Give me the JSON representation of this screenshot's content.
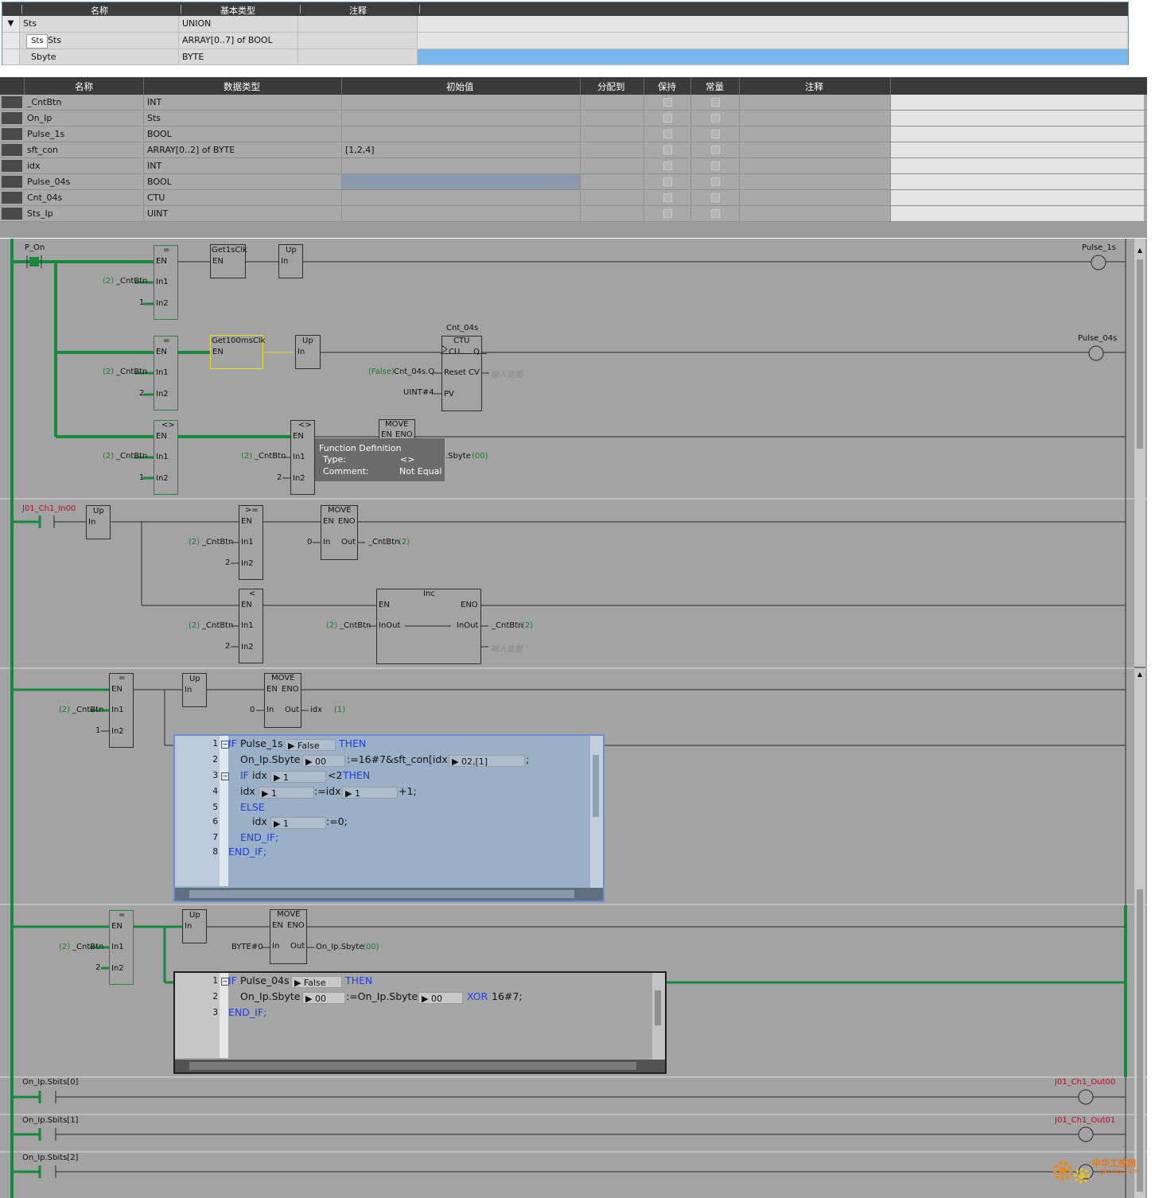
{
  "union_table": {
    "headers": [
      "名称",
      "基本类型",
      "注释"
    ],
    "rows": [
      {
        "expander": "▼",
        "name": "Sts",
        "type": "UNION"
      },
      {
        "name": "Sts",
        "tag": "Sts",
        "type": "ARRAY[0..7] of BOOL"
      },
      {
        "name": "Sbyte",
        "type": "BYTE"
      }
    ]
  },
  "var_table": {
    "headers": [
      "名称",
      "数据类型",
      "初始值",
      "分配到",
      "保持",
      "常量",
      "注释"
    ],
    "rows": [
      {
        "name": "_CntBtn",
        "type": "INT",
        "init": ""
      },
      {
        "name": "On_Ip",
        "type": "Sts",
        "init": ""
      },
      {
        "name": "Pulse_1s",
        "type": "BOOL",
        "init": ""
      },
      {
        "name": "sft_con",
        "type": "ARRAY[0..2] of BYTE",
        "init": "[1,2,4]"
      },
      {
        "name": "idx",
        "type": "INT",
        "init": ""
      },
      {
        "name": "Pulse_04s",
        "type": "BOOL",
        "init": ""
      },
      {
        "name": "Cnt_04s",
        "type": "CTU",
        "init": ""
      },
      {
        "name": "Sts_Ip",
        "type": "UINT",
        "init": ""
      }
    ]
  },
  "ladder": {
    "r1": {
      "contact": "P_On",
      "eq1": {
        "op": "=",
        "en": "EN",
        "in1": "In1",
        "in2": "In2",
        "in1_val": "_CntBtn",
        "in1_mon": "(2)",
        "in2_val": "1"
      },
      "get1s": {
        "name": "Get1sClk",
        "en": "EN"
      },
      "up1": {
        "name": "Up",
        "in": "In"
      },
      "coil1": "Pulse_1s",
      "eq2": {
        "op": "=",
        "en": "EN",
        "in1": "In1",
        "in2": "In2",
        "in1_val": "_CntBtn",
        "in1_mon": "(2)",
        "in2_val": "2"
      },
      "get100": {
        "name": "Get100msClk",
        "en": "EN"
      },
      "up2": {
        "name": "Up",
        "in": "In"
      },
      "ctu_inst": "Cnt_04s",
      "ctu": {
        "name": "CTU",
        "cu": "CU",
        "q": "Q",
        "reset": "Reset",
        "cv": "CV",
        "pv": "PV"
      },
      "reset_mon": "(False)",
      "reset_val": "Cnt_04s.Q",
      "pv_val": "UINT#4",
      "cv_hint": "输入变量",
      "coil2": "Pulse_04s",
      "ne1": {
        "op": "<>",
        "en": "EN",
        "in1": "In1",
        "in2": "In2",
        "in1_val": "_CntBtn",
        "in1_mon": "(2)",
        "in2_val": "1"
      },
      "ne2": {
        "op": "<>",
        "en": "EN",
        "in1": "In1",
        "in2": "In2",
        "in1_val": "_CntBtn",
        "in1_mon": "(2)",
        "in2_val": "2"
      },
      "move": {
        "name": "MOVE",
        "en": "EN",
        "eno": "ENO"
      },
      "move_out": ".Sbyte",
      "move_out_mon": "(00)",
      "tooltip": {
        "title": "Function Definition",
        "type_label": "Type:",
        "type_val": "<>",
        "comment_label": "Comment:",
        "comment_val": "Not Equal"
      }
    },
    "r2": {
      "contact": "J01_Ch1_In00",
      "up": {
        "name": "Up",
        "in": "In"
      },
      "ge": {
        "op": ">=",
        "en": "EN",
        "in1": "In1",
        "in2": "In2",
        "in1_val": "_CntBtn",
        "in1_mon": "(2)",
        "in2_val": "2"
      },
      "move": {
        "name": "MOVE",
        "en": "EN",
        "eno": "ENO",
        "in": "In",
        "out": "Out",
        "in_val": "0",
        "out_val": "_CntBtn",
        "out_mon": "(2)"
      },
      "lt": {
        "op": "<",
        "en": "EN",
        "in1": "In1",
        "in2": "In2",
        "in1_val": "_CntBtn",
        "in1_mon": "(2)",
        "in2_val": "2"
      },
      "inc": {
        "name": "Inc",
        "en": "EN",
        "eno": "ENO",
        "inout": "InOut",
        "inout2": "InOut",
        "in_val": "_CntBtn",
        "in_mon": "(2)",
        "out_val": "_CntBtn",
        "out_mon": "(2)",
        "hint": "输入变量"
      }
    },
    "r3": {
      "eq": {
        "op": "=",
        "en": "EN",
        "in1": "In1",
        "in2": "In2",
        "in1_val": "_CntBtn",
        "in1_mon": "(2)",
        "in2_val": "1"
      },
      "up": {
        "name": "Up",
        "in": "In"
      },
      "move": {
        "name": "MOVE",
        "en": "EN",
        "eno": "ENO",
        "in": "In",
        "out": "Out",
        "in_val": "0",
        "out_val": "idx",
        "out_mon": "(1)"
      },
      "st_lines": [
        "1",
        "2",
        "3",
        "4",
        "5",
        "6",
        "7",
        "8"
      ],
      "st": {
        "l1_if": "IF",
        "l1_var": "Pulse_1s",
        "l1_mon": "False",
        "l1_then": "THEN",
        "l2_a": "On_Ip.Sbyte",
        "l2_mon": "00",
        "l2_b": ":=16#7&sft_con[idx]",
        "l2_mon2": "02,[1]",
        "l2_end": ";",
        "l3_if": "IF",
        "l3_a": "idx",
        "l3_mon": "1",
        "l3_b": "<2",
        "l3_then": "THEN",
        "l4_a": "idx",
        "l4_mon": "1",
        "l4_b": ":=idx",
        "l4_mon2": "1",
        "l4_c": "+1;",
        "l5_else": "ELSE",
        "l6_a": "idx",
        "l6_mon": "1",
        "l6_b": ":=0;",
        "l7_end": "END_IF;",
        "l8_end": "END_IF;"
      }
    },
    "r4": {
      "eq": {
        "op": "=",
        "en": "EN",
        "in1": "In1",
        "in2": "In2",
        "in1_val": "_CntBtn",
        "in1_mon": "(2)",
        "in2_val": "2"
      },
      "up": {
        "name": "Up",
        "in": "In"
      },
      "move": {
        "name": "MOVE",
        "en": "EN",
        "eno": "ENO",
        "in": "In",
        "out": "Out",
        "in_val": "BYTE#0",
        "out_val": "On_Ip.Sbyte",
        "out_mon": "(00)"
      },
      "st_lines": [
        "1",
        "2",
        "3"
      ],
      "st": {
        "l1_if": "IF",
        "l1_var": "Pulse_04s",
        "l1_mon": "False",
        "l1_then": "THEN",
        "l2_a": "On_Ip.Sbyte",
        "l2_mon": "00",
        "l2_b": ":=On_Ip.Sbyte",
        "l2_mon2": "00",
        "l2_xor": "XOR",
        "l2_c": "16#7;",
        "l3_end": "END_IF;"
      }
    },
    "r5": {
      "contact": "On_Ip.Sbits[0]",
      "coil": "J01_Ch1_Out00"
    },
    "r6": {
      "contact": "On_Ip.Sbits[1]",
      "coil": "J01_Ch1_Out01"
    },
    "r7": {
      "contact": "On_Ip.Sbits[2]",
      "coil": ""
    }
  },
  "watermark": {
    "text": "中华工控网",
    "url": "gkong.com"
  },
  "colors": {
    "power": "#168a3a",
    "wire": "#2a2a2a",
    "header": "#3a3a3a",
    "selected_row": "#7ab8ec"
  }
}
